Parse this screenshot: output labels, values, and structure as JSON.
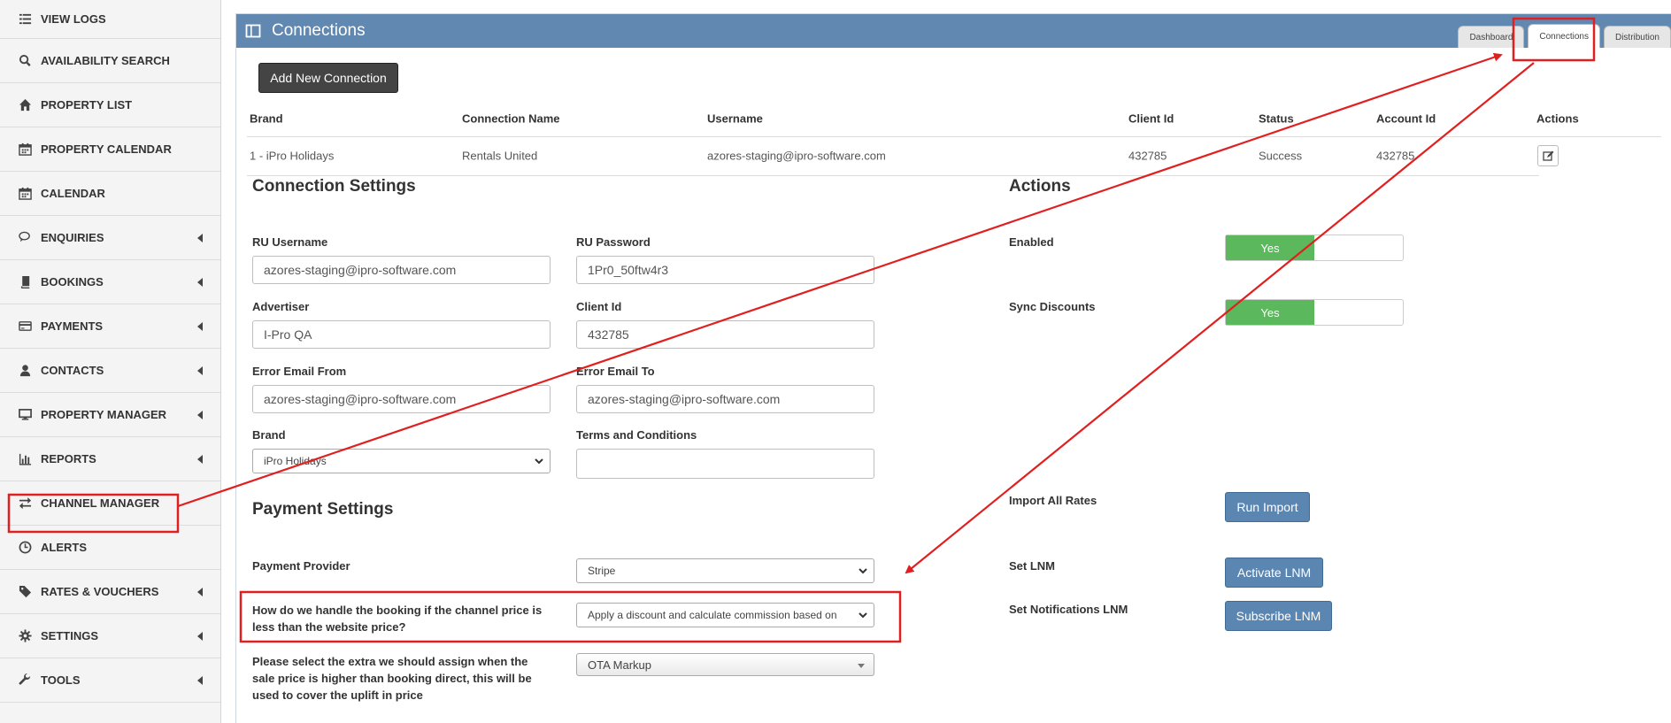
{
  "sidebar": {
    "items": [
      {
        "label": "VIEW LOGS",
        "icon": "list-icon",
        "caret": false
      },
      {
        "label": "AVAILABILITY SEARCH",
        "icon": "search-icon",
        "caret": false
      },
      {
        "label": "PROPERTY LIST",
        "icon": "home-icon",
        "caret": false
      },
      {
        "label": "PROPERTY CALENDAR",
        "icon": "calendar-icon",
        "caret": false
      },
      {
        "label": "CALENDAR",
        "icon": "calendar-icon",
        "caret": false
      },
      {
        "label": "ENQUIRIES",
        "icon": "chat-icon",
        "caret": true
      },
      {
        "label": "BOOKINGS",
        "icon": "book-icon",
        "caret": true
      },
      {
        "label": "PAYMENTS",
        "icon": "credit-card-icon",
        "caret": true
      },
      {
        "label": "CONTACTS",
        "icon": "user-icon",
        "caret": true
      },
      {
        "label": "PROPERTY MANAGER",
        "icon": "monitor-icon",
        "caret": true
      },
      {
        "label": "REPORTS",
        "icon": "bar-chart-icon",
        "caret": true
      },
      {
        "label": "CHANNEL MANAGER",
        "icon": "exchange-icon",
        "caret": false
      },
      {
        "label": "ALERTS",
        "icon": "clock-icon",
        "caret": false
      },
      {
        "label": "RATES & VOUCHERS",
        "icon": "tag-icon",
        "caret": true
      },
      {
        "label": "SETTINGS",
        "icon": "gear-icon",
        "caret": true
      },
      {
        "label": "TOOLS",
        "icon": "wrench-icon",
        "caret": true
      }
    ]
  },
  "header": {
    "title": "Connections",
    "tabs": [
      {
        "label": "Dashboard",
        "active": false
      },
      {
        "label": "Connections",
        "active": true
      },
      {
        "label": "Distribution",
        "active": false
      }
    ]
  },
  "add_connection_label": "Add New Connection",
  "table": {
    "headers": [
      "Brand",
      "Connection Name",
      "Username",
      "Client Id",
      "Status",
      "Account Id",
      "Actions"
    ],
    "rows": [
      [
        "1 - iPro Holidays",
        "Rentals United",
        "azores-staging@ipro-software.com",
        "432785",
        "Success",
        "432785"
      ]
    ]
  },
  "connection_settings": {
    "title": "Connection Settings",
    "ru_username": {
      "label": "RU Username",
      "value": "azores-staging@ipro-software.com"
    },
    "ru_password": {
      "label": "RU Password",
      "value": "1Pr0_50ftw4r3"
    },
    "advertiser": {
      "label": "Advertiser",
      "value": "I-Pro QA"
    },
    "client_id": {
      "label": "Client Id",
      "value": "432785"
    },
    "error_email_from": {
      "label": "Error Email From",
      "value": "azores-staging@ipro-software.com"
    },
    "error_email_to": {
      "label": "Error Email To",
      "value": "azores-staging@ipro-software.com"
    },
    "brand": {
      "label": "Brand",
      "value": "iPro Holidays"
    },
    "terms": {
      "label": "Terms and Conditions",
      "value": ""
    }
  },
  "actions": {
    "title": "Actions",
    "enabled": {
      "label": "Enabled",
      "value": "Yes"
    },
    "sync_discounts": {
      "label": "Sync Discounts",
      "value": "Yes"
    },
    "import_all_rates": {
      "label": "Import All Rates",
      "button": "Run Import"
    },
    "set_lnm": {
      "label": "Set LNM",
      "button": "Activate LNM"
    },
    "set_notifications_lnm": {
      "label": "Set Notifications LNM",
      "button": "Subscribe LNM"
    }
  },
  "payment_settings": {
    "title": "Payment Settings",
    "payment_provider": {
      "label": "Payment Provider",
      "value": "Stripe"
    },
    "channel_price": {
      "label": "How do we handle the booking if the channel price is less than the website price?",
      "value": "Apply a discount and calculate commission based on"
    },
    "extra": {
      "label": "Please select the extra we should assign when the sale price is higher than booking direct, this will be used to cover the uplift in price",
      "value": "OTA Markup"
    }
  },
  "colors": {
    "header_bg": "#6088b0",
    "highlight": "#e02020",
    "toggle_on": "#5cb85c",
    "button_blue": "#5b86b2"
  }
}
